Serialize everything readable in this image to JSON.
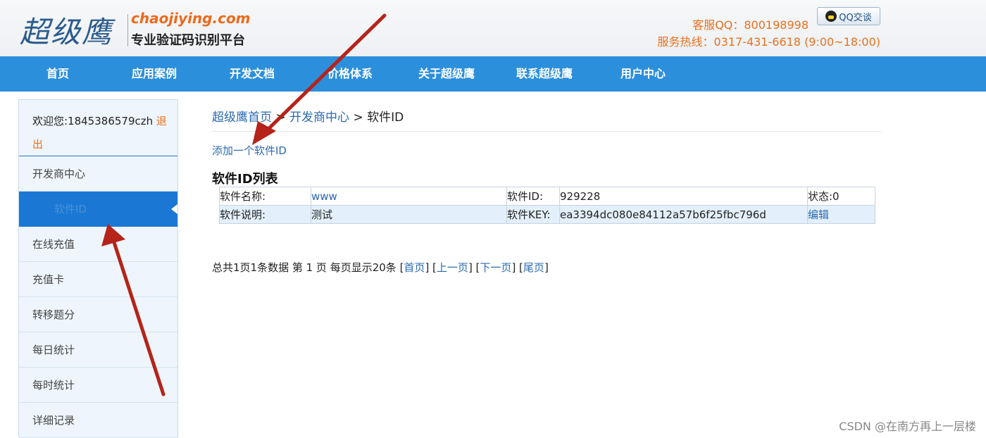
{
  "header": {
    "logo_calligraphy": "超级鹰",
    "logo_domain": "chaojiying.com",
    "logo_tagline": "专业验证码识别平台",
    "service_qq": "客服QQ：800198998",
    "qq_button": "QQ交谈",
    "service_phone": "服务热线：0317-431-6618 (9:00~18:00)"
  },
  "nav": [
    "首页",
    "应用案例",
    "开发文档",
    "价格体系",
    "关于超级鹰",
    "联系超级鹰",
    "用户中心"
  ],
  "sidebar": {
    "welcome": "欢迎您:1845386579czh",
    "logout": "退出",
    "items": [
      "开发商中心",
      "软件ID",
      "在线充值",
      "充值卡",
      "转移题分",
      "每日统计",
      "每时统计",
      "详细记录"
    ],
    "active_index": 1
  },
  "breadcrumb": {
    "home": "超级鹰首页",
    "sep1": " > ",
    "dev": "开发商中心",
    "sep2": " > ",
    "current": "软件ID"
  },
  "add_link": "添加一个软件ID",
  "list_title": "软件ID列表",
  "software_table": {
    "row1": {
      "name_label": "软件名称:",
      "name_value": "www",
      "id_label": "软件ID:",
      "id_value": "929228",
      "status": "状态:0"
    },
    "row2": {
      "desc_label": "软件说明:",
      "desc_value": "测试",
      "key_label": "软件KEY:",
      "key_value": "ea3394dc080e84112a57b6f25fbc796d",
      "edit": "编辑"
    }
  },
  "pager": {
    "summary": "总共1页1条数据 第 1 页 每页显示20条 ",
    "first": "首页",
    "prev": "上一页",
    "next": "下一页",
    "last": "尾页"
  },
  "watermark": "CSDN @在南方再上一层楼",
  "colors": {
    "nav_blue": "#2c8fdb",
    "active_blue": "#1a78d4",
    "orange": "#e8711e",
    "link_blue": "#2a6ab0",
    "annotation_red": "#b5231a"
  }
}
